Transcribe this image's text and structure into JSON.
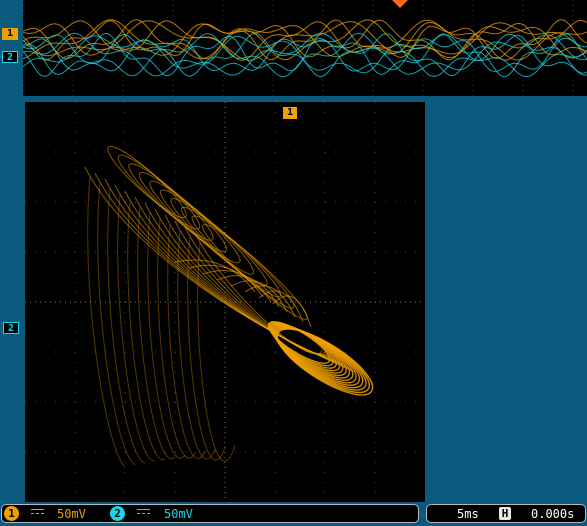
{
  "channels": {
    "ch1": {
      "marker": "1",
      "color": "#f0a000"
    },
    "ch2": {
      "marker": "2",
      "color": "#19d7e6"
    }
  },
  "top_strip": {
    "trigger_marker": "trigger-position-marker"
  },
  "xy_view": {
    "ch1_marker": "1",
    "ch2_marker": "2"
  },
  "status": {
    "ch1_badge": "1",
    "ch1_scale": "50mV",
    "ch2_badge": "2",
    "ch2_scale": "50mV",
    "timebase": "5ms",
    "hold_icon": "H",
    "offset": "0.000s"
  },
  "icons": [
    "dc-coupling-icon",
    "hold-icon",
    "trigger-arrow-icon"
  ]
}
